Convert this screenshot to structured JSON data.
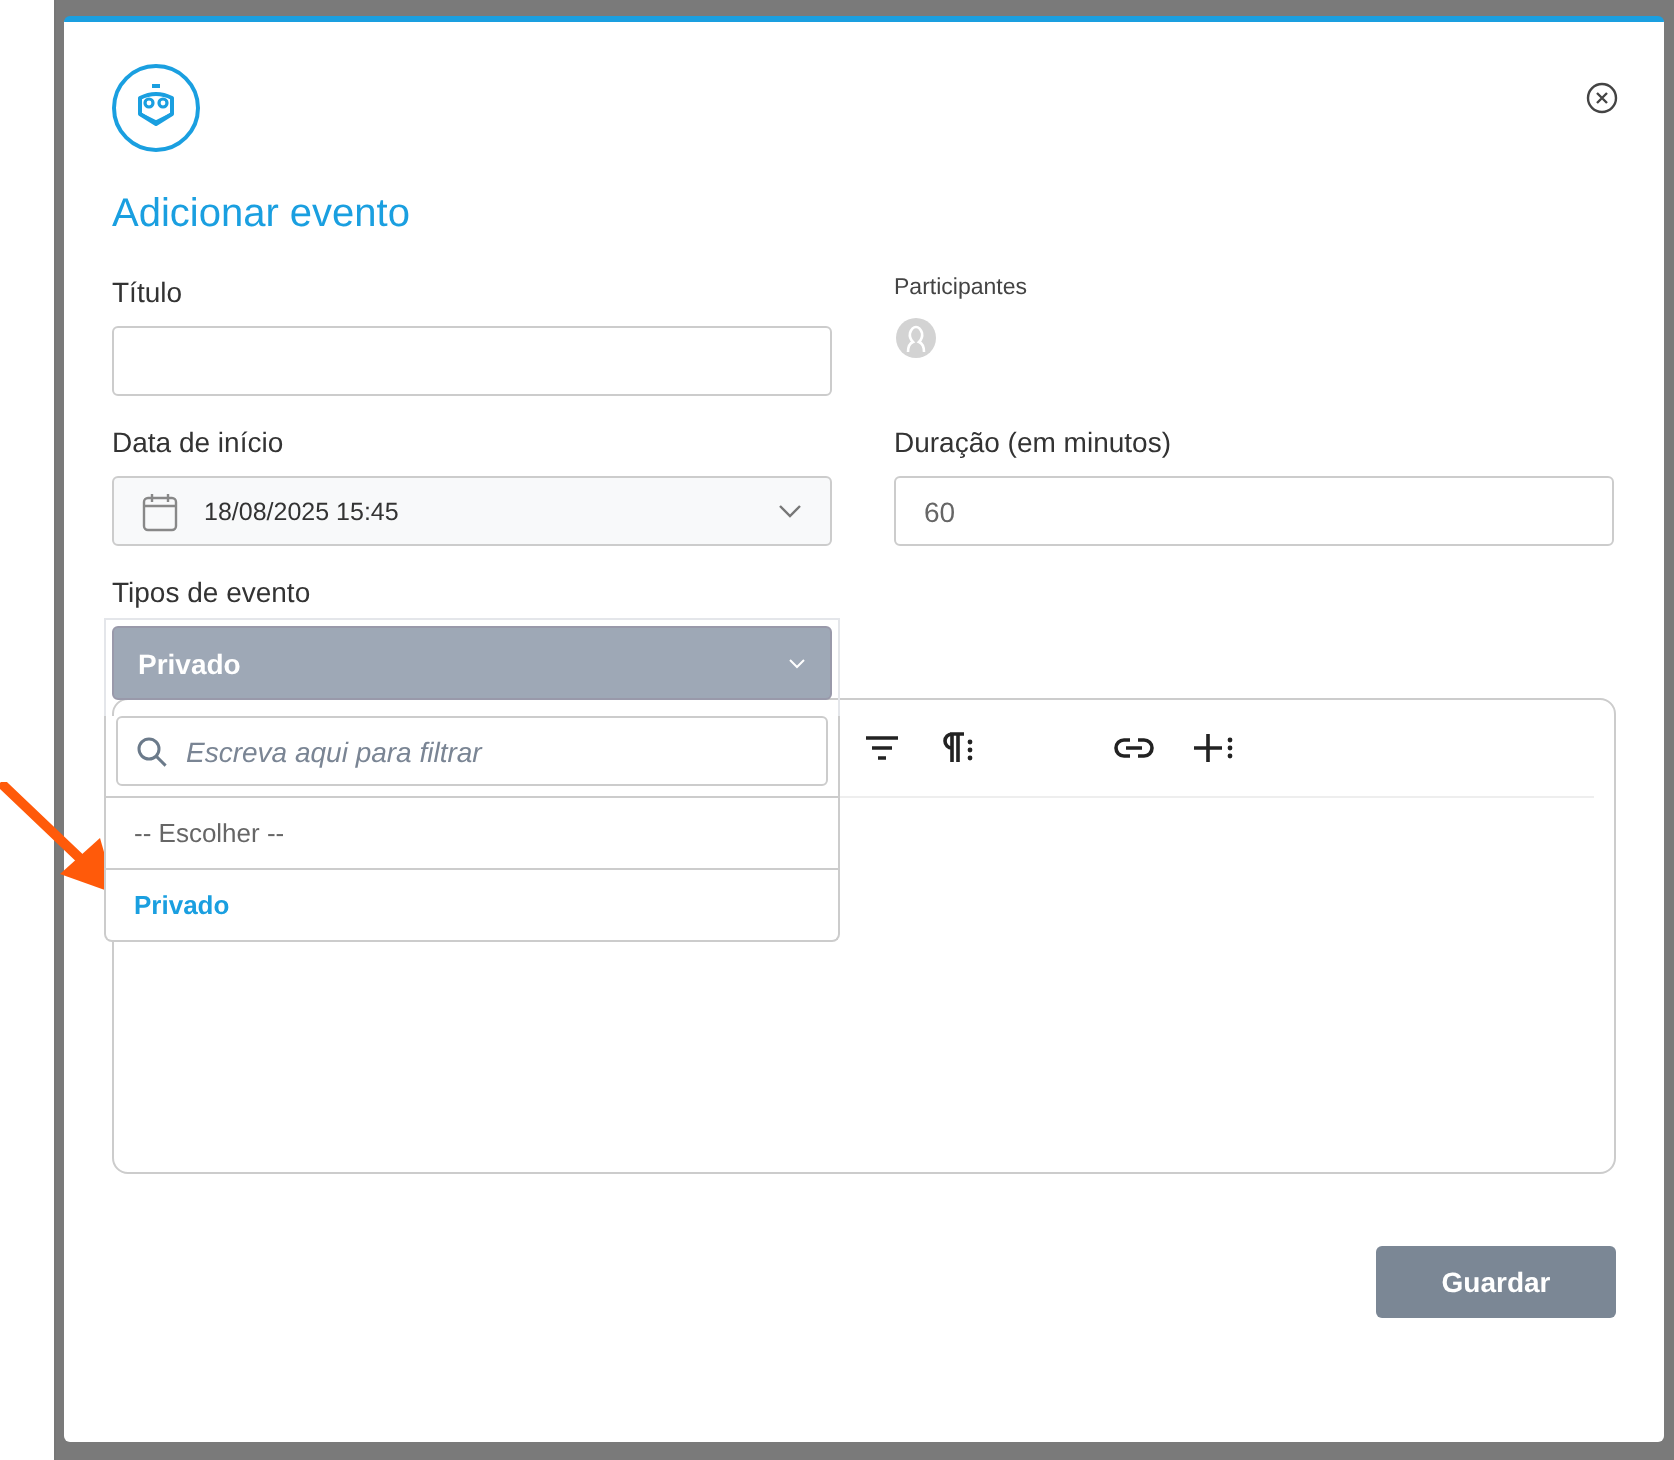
{
  "dialog": {
    "title": "Adicionar evento"
  },
  "fields": [
    {
      "kind": "text",
      "label": "Título"
    },
    {
      "kind": "participants",
      "label": "Participantes"
    },
    {
      "kind": "date",
      "label": "Data de início",
      "value": "18/08/2025 15:45"
    },
    {
      "kind": "text",
      "label": "Duração (em minutos)",
      "value": "60"
    }
  ],
  "event_type": {
    "label": "Tipos de evento",
    "value": "Privado",
    "expanded": true,
    "filter_placeholder": "Escreva aqui para filtrar",
    "options": [
      {
        "label": "-- Escolher --",
        "selected": false
      },
      {
        "label": "Privado",
        "selected": true
      }
    ]
  },
  "save_button": "Guardar"
}
